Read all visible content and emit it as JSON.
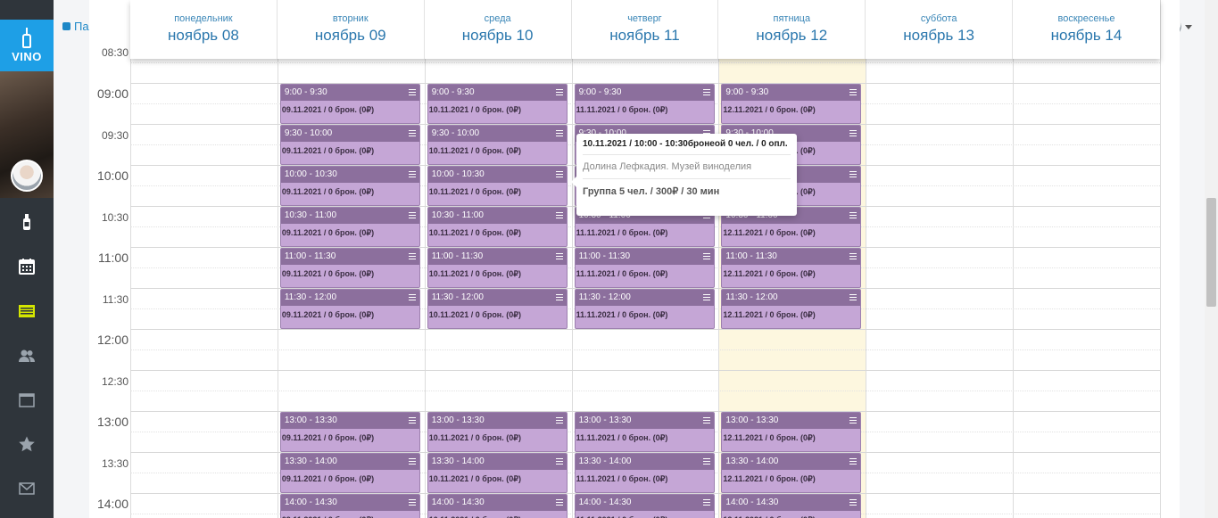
{
  "app": {
    "logo_text": "VINO",
    "panel_link": "Панель упр"
  },
  "colors": {
    "sidebar": "#2f353b",
    "accent": "#1e9fe6",
    "event": "#c5a6d6",
    "event_header": "#8c6f9d",
    "today": "#fdf7df"
  },
  "sidebar": {
    "items": [
      {
        "icon": "wine-bottle-icon"
      },
      {
        "icon": "calendar-icon"
      },
      {
        "icon": "list-icon"
      },
      {
        "icon": "users-icon"
      },
      {
        "icon": "window-icon"
      },
      {
        "icon": "star-icon"
      },
      {
        "icon": "mail-icon"
      }
    ]
  },
  "times": [
    {
      "label": "09:00",
      "kind": "hour"
    },
    {
      "label": "09:30",
      "kind": "half"
    },
    {
      "label": "10:00",
      "kind": "hour"
    },
    {
      "label": "10:30",
      "kind": "half"
    },
    {
      "label": "11:00",
      "kind": "hour"
    },
    {
      "label": "11:30",
      "kind": "half"
    },
    {
      "label": "12:00",
      "kind": "hour"
    },
    {
      "label": "12:30",
      "kind": "half"
    },
    {
      "label": "13:00",
      "kind": "hour"
    },
    {
      "label": "13:30",
      "kind": "half"
    },
    {
      "label": "14:00",
      "kind": "hour"
    }
  ],
  "partial_time_label": "08:30",
  "days": [
    {
      "dow": "понедельник",
      "date": "ноябрь 08"
    },
    {
      "dow": "вторник",
      "date": "ноябрь 09",
      "full": "09.11.2021"
    },
    {
      "dow": "среда",
      "date": "ноябрь 10",
      "full": "10.11.2021"
    },
    {
      "dow": "четверг",
      "date": "ноябрь 11",
      "full": "11.11.2021"
    },
    {
      "dow": "пятница",
      "date": "ноябрь 12",
      "full": "12.11.2021",
      "today": true
    },
    {
      "dow": "суббота",
      "date": "ноябрь 13"
    },
    {
      "dow": "воскресенье",
      "date": "ноябрь 14"
    }
  ],
  "slots": [
    "9:00 - 9:30",
    "9:30 - 10:00",
    "10:00 - 10:30",
    "10:30 - 11:00",
    "11:00 - 11:30",
    "11:30 - 12:00",
    "",
    "",
    "13:00 - 13:30",
    "13:30 - 14:00",
    "14:00 - 14:30"
  ],
  "event_suffix": " / 0 брон. (0₽)",
  "tooltip": {
    "title": "10.11.2021 / 10:00 - 10:30бронеой 0 чел. / 0 опл.",
    "place": "Долина Лефкадия. Музей винodelия",
    "group": "Группа 5 чел. / 300₽ / 30 мин"
  }
}
